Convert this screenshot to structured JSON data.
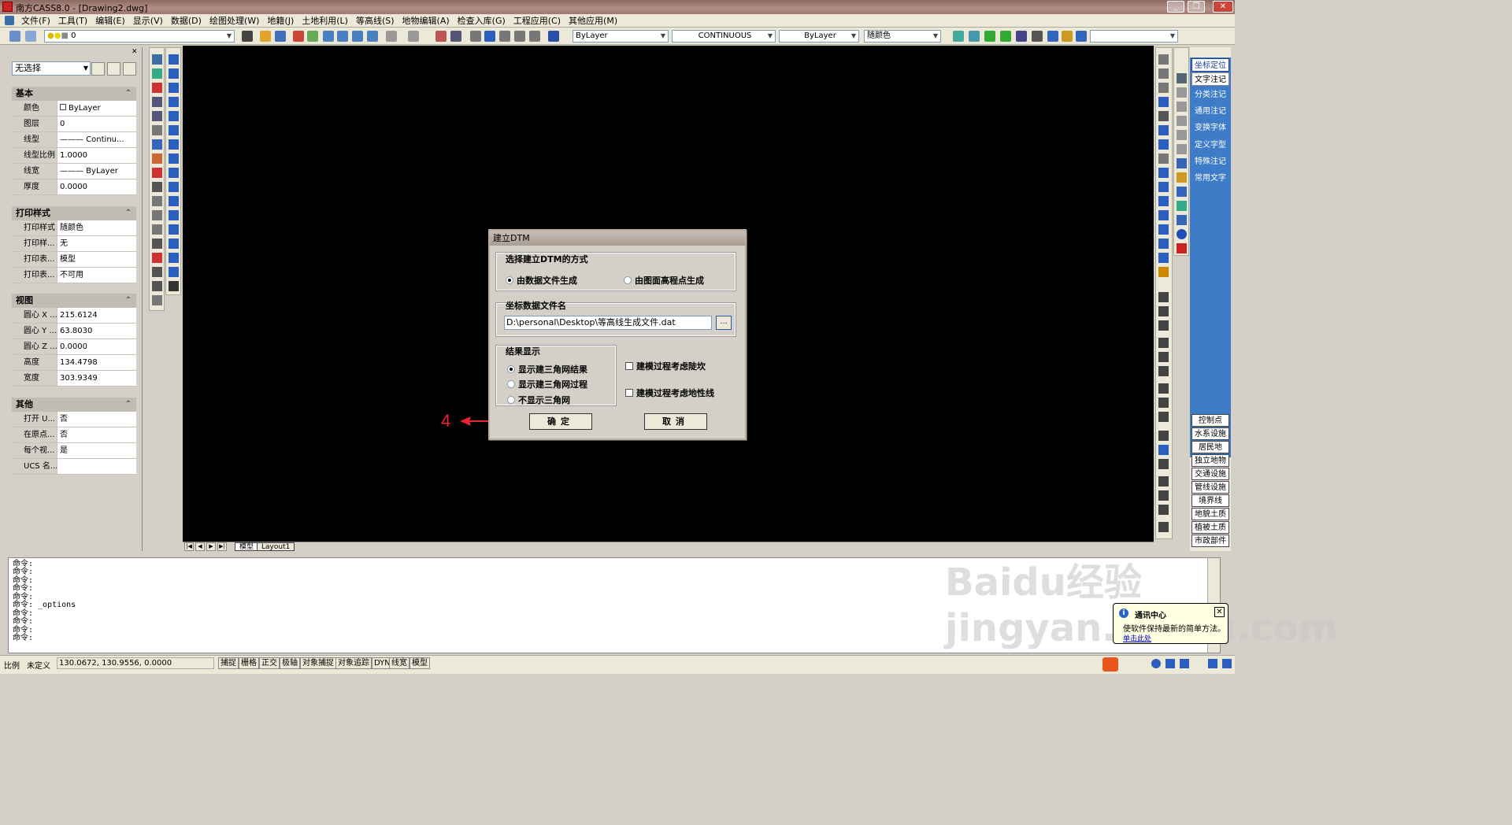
{
  "window": {
    "title": "南方CASS8.0 - [Drawing2.dwg]"
  },
  "menu": [
    "文件(F)",
    "工具(T)",
    "编辑(E)",
    "显示(V)",
    "数据(D)",
    "绘图处理(W)",
    "地籍(J)",
    "土地利用(L)",
    "等高线(S)",
    "地物编辑(A)",
    "检查入库(G)",
    "工程应用(C)",
    "其他应用(M)"
  ],
  "toolbar": {
    "layer_value": "0",
    "color_combo": "ByLayer",
    "linetype_combo": "CONTINUOUS",
    "lineweight_combo": "ByLayer",
    "plotstyle_combo": "随颜色"
  },
  "properties": {
    "selection": "无选择",
    "sections": [
      {
        "title": "基本",
        "rows": [
          {
            "k": "颜色",
            "v": "ByLayer"
          },
          {
            "k": "图层",
            "v": "0"
          },
          {
            "k": "线型",
            "v": "——— Continu..."
          },
          {
            "k": "线型比例",
            "v": "1.0000"
          },
          {
            "k": "线宽",
            "v": "——— ByLayer"
          },
          {
            "k": "厚度",
            "v": "0.0000"
          }
        ]
      },
      {
        "title": "打印样式",
        "rows": [
          {
            "k": "打印样式",
            "v": "随颜色"
          },
          {
            "k": "打印样...",
            "v": "无"
          },
          {
            "k": "打印表...",
            "v": "模型"
          },
          {
            "k": "打印表...",
            "v": "不可用"
          }
        ]
      },
      {
        "title": "视图",
        "rows": [
          {
            "k": "圆心 X ...",
            "v": "215.6124"
          },
          {
            "k": "圆心 Y ...",
            "v": "63.8030"
          },
          {
            "k": "圆心 Z ...",
            "v": "0.0000"
          },
          {
            "k": "高度",
            "v": "134.4798"
          },
          {
            "k": "宽度",
            "v": "303.9349"
          }
        ]
      },
      {
        "title": "其他",
        "rows": [
          {
            "k": "打开 U...",
            "v": "否"
          },
          {
            "k": "在原点...",
            "v": "否"
          },
          {
            "k": "每个视...",
            "v": "是"
          },
          {
            "k": "UCS 名...",
            "v": ""
          }
        ]
      }
    ]
  },
  "tabs": {
    "model": "模型",
    "layout": "Layout1"
  },
  "right_panel": {
    "top": [
      "坐标定位",
      "文字注记",
      "分类注记",
      "通用注记",
      "变换字体",
      "定义字型",
      "特殊注记",
      "常用文字"
    ],
    "bottom": [
      "控制点",
      "水系设施",
      "居民地",
      "独立地物",
      "交通设施",
      "管线设施",
      "境界线",
      "地貌土质",
      "植被土质",
      "市政部件"
    ]
  },
  "dialog": {
    "title": "建立DTM",
    "method_group": "选择建立DTM的方式",
    "method_options": [
      "由数据文件生成",
      "由图面高程点生成"
    ],
    "file_group": "坐标数据文件名",
    "file_path": "D:\\personal\\Desktop\\等高线生成文件.dat",
    "browse_label": "...",
    "result_group": "结果显示",
    "result_options": [
      "显示建三角网结果",
      "显示建三角网过程",
      "不显示三角网"
    ],
    "checkbox_1": "建模过程考虑陡坎",
    "checkbox_2": "建模过程考虑地性线",
    "ok_label": "确定",
    "cancel_label": "取消"
  },
  "annotation": {
    "step": "4"
  },
  "command_lines": [
    "命令:",
    "命令:",
    "命令:",
    "命令:",
    "命令:",
    "命令: _options",
    "命令:",
    "命令:",
    "命令:",
    "命令:"
  ],
  "status": {
    "scale_label": "比例",
    "scale_value": "未定义",
    "coords": "130.0672,  130.9556,  0.0000",
    "buttons": [
      "捕捉",
      "栅格",
      "正交",
      "极轴",
      "对象捕捉",
      "对象追踪",
      "DYN",
      "线宽",
      "模型"
    ]
  },
  "notification": {
    "title": "通讯中心",
    "body": "使软件保持最新的简单方法。",
    "link": "单击此处"
  },
  "watermark": "Baidu经验 jingyan.baidu.com"
}
